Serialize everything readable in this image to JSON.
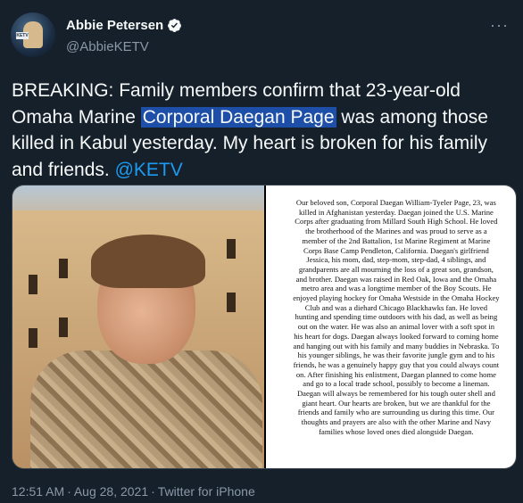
{
  "author": {
    "name": "Abbie Petersen",
    "handle": "@AbbieKETV",
    "avatar_label": "KETV",
    "verified_icon": "verified-badge-icon"
  },
  "more_icon": "more-dots-icon",
  "tweet": {
    "text_before": "BREAKING: Family members confirm that 23-year-old Omaha Marine ",
    "highlighted": "Corporal Daegan Page",
    "text_after": " was among those killed in Kabul yesterday. My heart is broken for his family and friends. ",
    "mention": "@KETV"
  },
  "statement": {
    "text": "Our beloved son, Corporal Daegan William-Tyeler Page, 23, was killed in Afghanistan yesterday. Daegan joined the U.S. Marine Corps after graduating from Millard South High School. He loved the brotherhood of the Marines and was proud to serve as a member of the 2nd Battalion, 1st Marine Regiment at Marine Corps Base Camp Pendleton, California. Daegan's girlfriend Jessica, his mom, dad, step-mom, step-dad, 4 siblings, and grandparents are all mourning the loss of a great son, grandson, and brother. Daegan was raised in Red Oak, Iowa and the Omaha metro area and was a longtime member of the Boy Scouts. He enjoyed playing hockey for Omaha Westside in the Omaha Hockey Club and was a diehard Chicago Blackhawks fan. He loved hunting and spending time outdoors with his dad, as well as being out on the water. He was also an animal lover with a soft spot in his heart for dogs. Daegan always looked forward to coming home and hanging out with his family and many buddies in Nebraska. To his younger siblings, he was their favorite jungle gym and to his friends, he was a genuinely happy guy that you could always count on. After finishing his enlistment, Daegan planned to come home and go to a local trade school, possibly to become a lineman. Daegan will always be remembered for his tough outer shell and giant heart. Our hearts are broken, but we are thankful for the friends and family who are surrounding us during this time. Our thoughts and prayers are also with the other Marine and Navy families whose loved ones died alongside Daegan."
  },
  "meta": {
    "time": "12:51 AM",
    "separator": "·",
    "date": "Aug 28, 2021",
    "source": "Twitter for iPhone"
  },
  "colors": {
    "background": "#15202b",
    "accent": "#1d9bf0",
    "highlight": "#1d4fa8",
    "secondary_text": "#8b98a5"
  }
}
